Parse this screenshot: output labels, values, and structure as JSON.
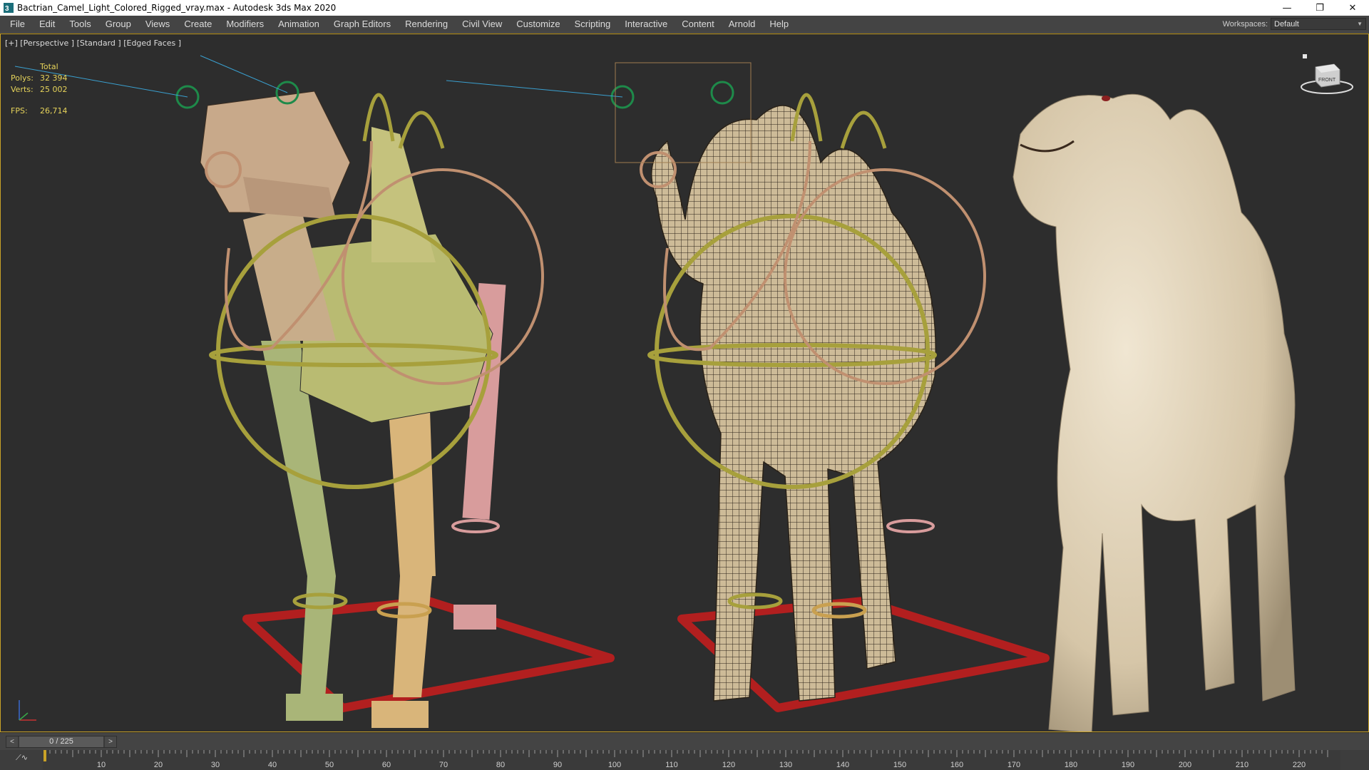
{
  "window": {
    "title": "Bactrian_Camel_Light_Colored_Rigged_vray.max - Autodesk 3ds Max 2020",
    "minimize": "—",
    "restore": "❐",
    "close": "✕"
  },
  "menu": {
    "items": [
      "File",
      "Edit",
      "Tools",
      "Group",
      "Views",
      "Create",
      "Modifiers",
      "Animation",
      "Graph Editors",
      "Rendering",
      "Civil View",
      "Customize",
      "Scripting",
      "Interactive",
      "Content",
      "Arnold",
      "Help"
    ],
    "workspaces_label": "Workspaces:",
    "workspaces_value": "Default"
  },
  "viewport": {
    "label": "[+] [Perspective ] [Standard ] [Edged Faces ]",
    "border_color": "#c9a227",
    "viewcube_label": "FRONT"
  },
  "stats": {
    "header": "Total",
    "polys_label": "Polys:",
    "polys_value": "32 394",
    "verts_label": "Verts:",
    "verts_value": "25 002",
    "fps_label": "FPS:",
    "fps_value": "26,714",
    "color": "#e6d35a"
  },
  "timeline": {
    "frame_display": "0 / 225",
    "prev": "<",
    "next": ">",
    "ticks": [
      "10",
      "20",
      "30",
      "40",
      "50",
      "60",
      "70",
      "80",
      "90",
      "100",
      "110",
      "120",
      "130",
      "140",
      "150",
      "160",
      "170",
      "180",
      "190",
      "200",
      "210",
      "220"
    ]
  }
}
